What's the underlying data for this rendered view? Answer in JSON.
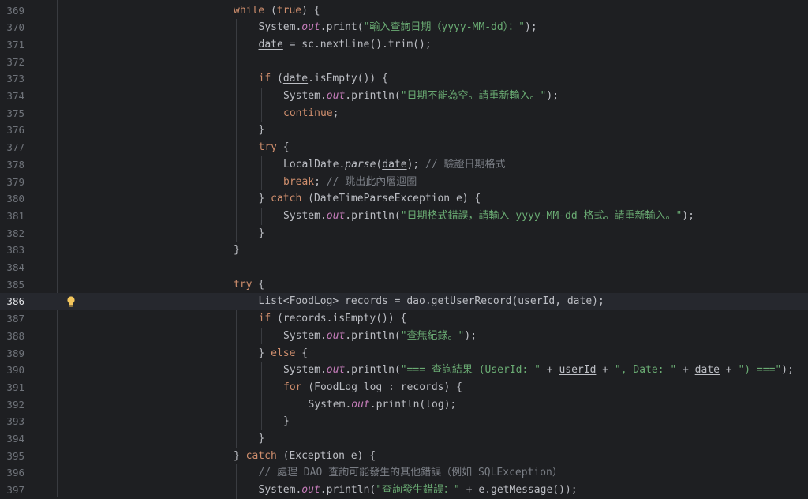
{
  "editor": {
    "current_line": "386",
    "colors": {
      "background": "#1e1f22",
      "keyword": "#cf8e6d",
      "string": "#6aab73",
      "field": "#c77dbb",
      "comment": "#7a7e85",
      "text": "#bcbec4",
      "line_number": "#6f737a"
    },
    "lines": [
      {
        "num": "369",
        "indent": 0,
        "tokens": [
          [
            "kw",
            "while"
          ],
          [
            "p",
            " ("
          ],
          [
            "kw",
            "true"
          ],
          [
            "p",
            ") {"
          ]
        ]
      },
      {
        "num": "370",
        "indent": 1,
        "tokens": [
          [
            "p",
            "System."
          ],
          [
            "field",
            "out"
          ],
          [
            "p",
            ".print("
          ],
          [
            "str",
            "\"輸入查詢日期（yyyy-MM-dd）：\""
          ],
          [
            "p",
            ");"
          ]
        ]
      },
      {
        "num": "371",
        "indent": 1,
        "tokens": [
          [
            "var",
            "date"
          ],
          [
            "p",
            " = sc.nextLine().trim();"
          ]
        ]
      },
      {
        "num": "372",
        "indent": 1,
        "tokens": []
      },
      {
        "num": "373",
        "indent": 1,
        "tokens": [
          [
            "kw",
            "if"
          ],
          [
            "p",
            " ("
          ],
          [
            "var",
            "date"
          ],
          [
            "p",
            ".isEmpty()) {"
          ]
        ]
      },
      {
        "num": "374",
        "indent": 2,
        "tokens": [
          [
            "p",
            "System."
          ],
          [
            "field",
            "out"
          ],
          [
            "p",
            ".println("
          ],
          [
            "str",
            "\"日期不能為空。請重新輸入。\""
          ],
          [
            "p",
            ");"
          ]
        ]
      },
      {
        "num": "375",
        "indent": 2,
        "tokens": [
          [
            "kw",
            "continue"
          ],
          [
            "p",
            ";"
          ]
        ]
      },
      {
        "num": "376",
        "indent": 1,
        "tokens": [
          [
            "p",
            "}"
          ]
        ]
      },
      {
        "num": "377",
        "indent": 1,
        "tokens": [
          [
            "kw",
            "try"
          ],
          [
            "p",
            " {"
          ]
        ]
      },
      {
        "num": "378",
        "indent": 2,
        "tokens": [
          [
            "p",
            "LocalDate."
          ],
          [
            "static",
            "parse"
          ],
          [
            "p",
            "("
          ],
          [
            "var",
            "date"
          ],
          [
            "p",
            ");"
          ],
          [
            "cmt",
            " // 驗證日期格式"
          ]
        ]
      },
      {
        "num": "379",
        "indent": 2,
        "tokens": [
          [
            "kw",
            "break"
          ],
          [
            "p",
            ";"
          ],
          [
            "cmt",
            " // 跳出此內層迴圈"
          ]
        ]
      },
      {
        "num": "380",
        "indent": 1,
        "tokens": [
          [
            "p",
            "} "
          ],
          [
            "kw",
            "catch"
          ],
          [
            "p",
            " (DateTimeParseException e) {"
          ]
        ]
      },
      {
        "num": "381",
        "indent": 2,
        "tokens": [
          [
            "p",
            "System."
          ],
          [
            "field",
            "out"
          ],
          [
            "p",
            ".println("
          ],
          [
            "str",
            "\"日期格式錯誤，請輸入 yyyy-MM-dd 格式。請重新輸入。\""
          ],
          [
            "p",
            ");"
          ]
        ]
      },
      {
        "num": "382",
        "indent": 1,
        "tokens": [
          [
            "p",
            "}"
          ]
        ]
      },
      {
        "num": "383",
        "indent": 0,
        "tokens": [
          [
            "p",
            "}"
          ]
        ]
      },
      {
        "num": "384",
        "indent": 0,
        "tokens": []
      },
      {
        "num": "385",
        "indent": 0,
        "tokens": [
          [
            "kw",
            "try"
          ],
          [
            "p",
            " {"
          ]
        ]
      },
      {
        "num": "386",
        "indent": 1,
        "tokens": [
          [
            "p",
            "List<FoodLog> records = dao.getUserRecord("
          ],
          [
            "var",
            "userId"
          ],
          [
            "p",
            ", "
          ],
          [
            "var",
            "date"
          ],
          [
            "p",
            ");"
          ]
        ]
      },
      {
        "num": "387",
        "indent": 1,
        "tokens": [
          [
            "kw",
            "if"
          ],
          [
            "p",
            " (records.isEmpty()) {"
          ]
        ]
      },
      {
        "num": "388",
        "indent": 2,
        "tokens": [
          [
            "p",
            "System."
          ],
          [
            "field",
            "out"
          ],
          [
            "p",
            ".println("
          ],
          [
            "str",
            "\"查無紀錄。\""
          ],
          [
            "p",
            ");"
          ]
        ]
      },
      {
        "num": "389",
        "indent": 1,
        "tokens": [
          [
            "p",
            "} "
          ],
          [
            "kw",
            "else"
          ],
          [
            "p",
            " {"
          ]
        ]
      },
      {
        "num": "390",
        "indent": 2,
        "tokens": [
          [
            "p",
            "System."
          ],
          [
            "field",
            "out"
          ],
          [
            "p",
            ".println("
          ],
          [
            "str",
            "\"=== 查詢結果 (UserId: \""
          ],
          [
            "p",
            " + "
          ],
          [
            "var",
            "userId"
          ],
          [
            "p",
            " + "
          ],
          [
            "str",
            "\", Date: \""
          ],
          [
            "p",
            " + "
          ],
          [
            "var",
            "date"
          ],
          [
            "p",
            " + "
          ],
          [
            "str",
            "\") ===\""
          ],
          [
            "p",
            ");"
          ]
        ]
      },
      {
        "num": "391",
        "indent": 2,
        "tokens": [
          [
            "kw",
            "for"
          ],
          [
            "p",
            " (FoodLog log : records) {"
          ]
        ]
      },
      {
        "num": "392",
        "indent": 3,
        "tokens": [
          [
            "p",
            "System."
          ],
          [
            "field",
            "out"
          ],
          [
            "p",
            ".println(log);"
          ]
        ]
      },
      {
        "num": "393",
        "indent": 2,
        "tokens": [
          [
            "p",
            "}"
          ]
        ]
      },
      {
        "num": "394",
        "indent": 1,
        "tokens": [
          [
            "p",
            "}"
          ]
        ]
      },
      {
        "num": "395",
        "indent": 0,
        "tokens": [
          [
            "p",
            "} "
          ],
          [
            "kw",
            "catch"
          ],
          [
            "p",
            " (Exception e) {"
          ]
        ]
      },
      {
        "num": "396",
        "indent": 1,
        "tokens": [
          [
            "cmt",
            "// 處理 DAO 查詢可能發生的其他錯誤（例如 SQLException）"
          ]
        ]
      },
      {
        "num": "397",
        "indent": 1,
        "tokens": [
          [
            "p",
            "System."
          ],
          [
            "field",
            "out"
          ],
          [
            "p",
            ".println("
          ],
          [
            "str",
            "\"查詢發生錯誤：\""
          ],
          [
            "p",
            " + e.getMessage());"
          ]
        ]
      }
    ]
  }
}
